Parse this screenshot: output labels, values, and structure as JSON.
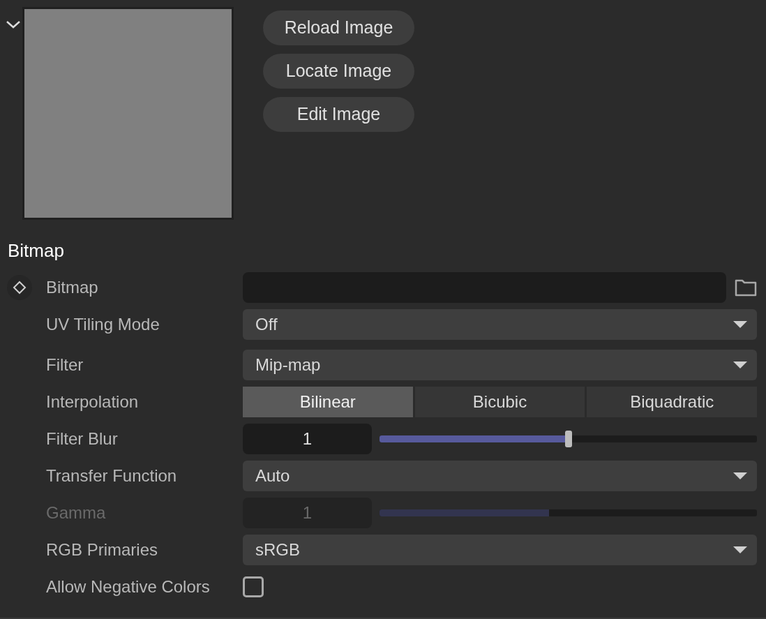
{
  "preview": {
    "expanded": true
  },
  "buttons": [
    "Reload Image",
    "Locate Image",
    "Edit Image"
  ],
  "section_title": "Bitmap",
  "rows": [
    {
      "kind": "file",
      "label": "Bitmap",
      "keyframe": true,
      "disabled": false
    },
    {
      "kind": "dropdown",
      "label": "UV Tiling Mode",
      "value": "Off",
      "disabled": false
    },
    {
      "kind": "dropdown",
      "label": "Filter",
      "value": "Mip-map",
      "disabled": false
    },
    {
      "kind": "segmented",
      "label": "Interpolation",
      "disabled": false,
      "options": [
        {
          "label": "Bilinear",
          "selected": true
        },
        {
          "label": "Bicubic",
          "selected": false
        },
        {
          "label": "Biquadratic",
          "selected": false
        }
      ]
    },
    {
      "kind": "slider",
      "label": "Filter Blur",
      "value": "1",
      "level": 0.5,
      "disabled": false
    },
    {
      "kind": "dropdown",
      "label": "Transfer Function",
      "value": "Auto",
      "disabled": false
    },
    {
      "kind": "slider",
      "label": "Gamma",
      "value": "1",
      "level": 0.45,
      "disabled": true
    },
    {
      "kind": "dropdown",
      "label": "RGB Primaries",
      "value": "sRGB",
      "disabled": false
    },
    {
      "kind": "checkbox",
      "label": "Allow Negative Colors",
      "checked": false,
      "disabled": false
    }
  ]
}
